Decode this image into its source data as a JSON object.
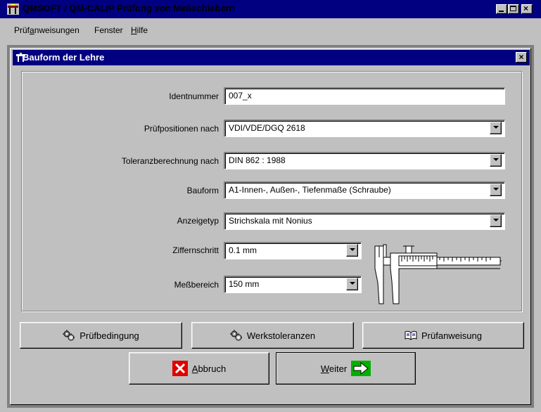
{
  "window": {
    "title": "QMSOFT / QM-CALIP Prüfung von Meßschiebern",
    "colors": {
      "titlebar": "#000080",
      "face": "#c0c0c0",
      "mdi_background": "#808080"
    }
  },
  "menu": {
    "items": [
      {
        "label": "Prüfanweisungen",
        "mnemonic_index": 3
      },
      {
        "label": "Fenster",
        "mnemonic_index": -1
      },
      {
        "label": "Hilfe",
        "mnemonic_index": 0
      }
    ]
  },
  "dialog": {
    "title": "Bauform der Lehre",
    "fields": {
      "identnummer": {
        "label": "Identnummer",
        "value": "007_x"
      },
      "pruefpositionen": {
        "label": "Prüfpositionen nach",
        "value": "VDI/VDE/DGQ 2618"
      },
      "toleranz": {
        "label": "Toleranzberechnung nach",
        "value": "DIN 862 : 1988"
      },
      "bauform": {
        "label": "Bauform",
        "value": "A1-Innen-, Außen-, Tiefenmaße (Schraube)"
      },
      "anzeigetyp": {
        "label": "Anzeigetyp",
        "value": "Strichskala mit Nonius"
      },
      "ziffernschritt": {
        "label": "Ziffernschritt",
        "value": "0.1 mm"
      },
      "messbereich": {
        "label": "Meßbereich",
        "value": "150 mm"
      }
    },
    "buttons": {
      "pruefbedingung": "Prüfbedingung",
      "werkstoleranzen": "Werkstoleranzen",
      "pruefanweisung": "Prüfanweisung",
      "abbruch_first": "A",
      "abbruch_rest": "bbruch",
      "weiter_first": "W",
      "weiter_rest": "eiter"
    },
    "icons": {
      "pruefbedingung": "gear-icon",
      "werkstoleranzen": "gear-icon",
      "pruefanweisung": "book-icon",
      "abbruch": "cancel-icon",
      "weiter": "arrow-right-icon",
      "caliper": "caliper-icon"
    }
  }
}
